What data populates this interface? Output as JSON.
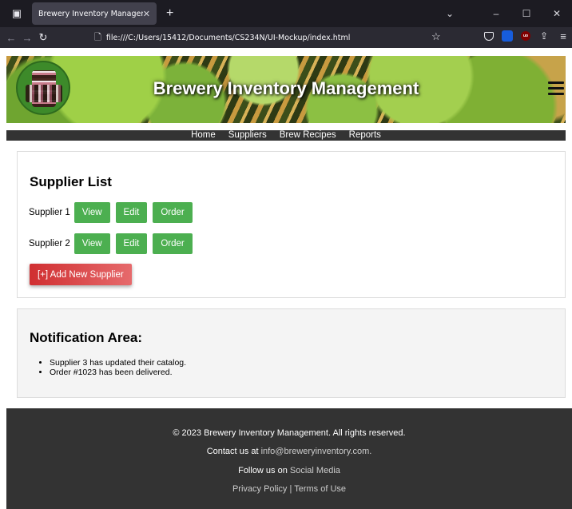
{
  "browser": {
    "tab_title": "Brewery Inventory Management",
    "tab_close": "✕",
    "new_tab": "+",
    "url": "file:///C:/Users/15412/Documents/CS234N/UI-Mockup/index.html",
    "controls": {
      "chevron": "⌄",
      "minimize": "–",
      "maximize": "☐",
      "close": "✕"
    }
  },
  "header": {
    "title": "Brewery Inventory Management"
  },
  "nav": [
    "Home",
    "Suppliers",
    "Brew Recipes",
    "Reports"
  ],
  "suppliers": {
    "title": "Supplier List",
    "rows": [
      {
        "name": "Supplier 1",
        "view": "View",
        "edit": "Edit",
        "order": "Order"
      },
      {
        "name": "Supplier 2",
        "view": "View",
        "edit": "Edit",
        "order": "Order"
      }
    ],
    "add_label": "[+] Add New Supplier"
  },
  "notifications": {
    "title": "Notification Area:",
    "items": [
      "Supplier 3 has updated their catalog.",
      "Order #1023 has been delivered."
    ]
  },
  "footer": {
    "copyright": "© 2023 Brewery Inventory Management. All rights reserved.",
    "contact_prefix": "Contact us at ",
    "contact_email": "info@breweryinventory.com.",
    "follow_prefix": "Follow us on ",
    "follow_link": "Social Media",
    "privacy": "Privacy Policy",
    "separator": " | ",
    "terms": "Terms of Use"
  },
  "colors": {
    "primary_green": "#4caf50",
    "danger_red": "#d9373a",
    "nav_bg": "#333333",
    "footer_bg": "#333333"
  }
}
